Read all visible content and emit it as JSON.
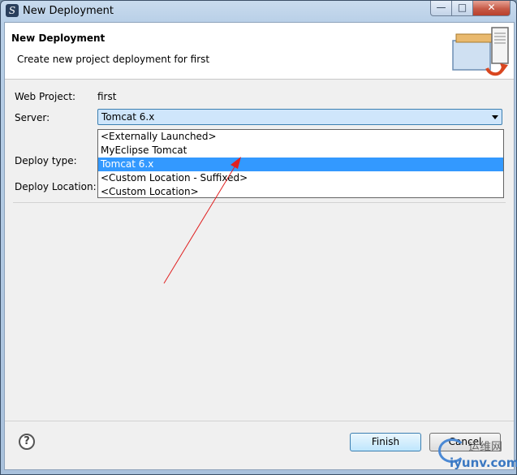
{
  "window": {
    "title": "New Deployment",
    "controls": {
      "minimize": "—",
      "maximize": "□",
      "close": "✕"
    },
    "app_icon": "S"
  },
  "banner": {
    "title": "New Deployment",
    "description": "Create new project deployment for first",
    "icon": "deploy-server-icon"
  },
  "form": {
    "web_project_label": "Web Project:",
    "web_project_value": "first",
    "server_label": "Server:",
    "server_value": "Tomcat  6.x",
    "deploy_type_label": "Deploy type:",
    "deploy_location_label": "Deploy Location:"
  },
  "dropdown": {
    "options": [
      "<Externally Launched>",
      "MyEclipse Tomcat",
      "Tomcat  6.x",
      "<Custom Location - Suffixed>",
      "<Custom Location>"
    ],
    "selected": "Tomcat  6.x"
  },
  "buttons": {
    "help": "?",
    "finish": "Finish",
    "cancel": "Cancel"
  },
  "annotation": {
    "color": "#e02020"
  },
  "watermark": {
    "line1": "运维网",
    "line2": "iyunv.com"
  }
}
